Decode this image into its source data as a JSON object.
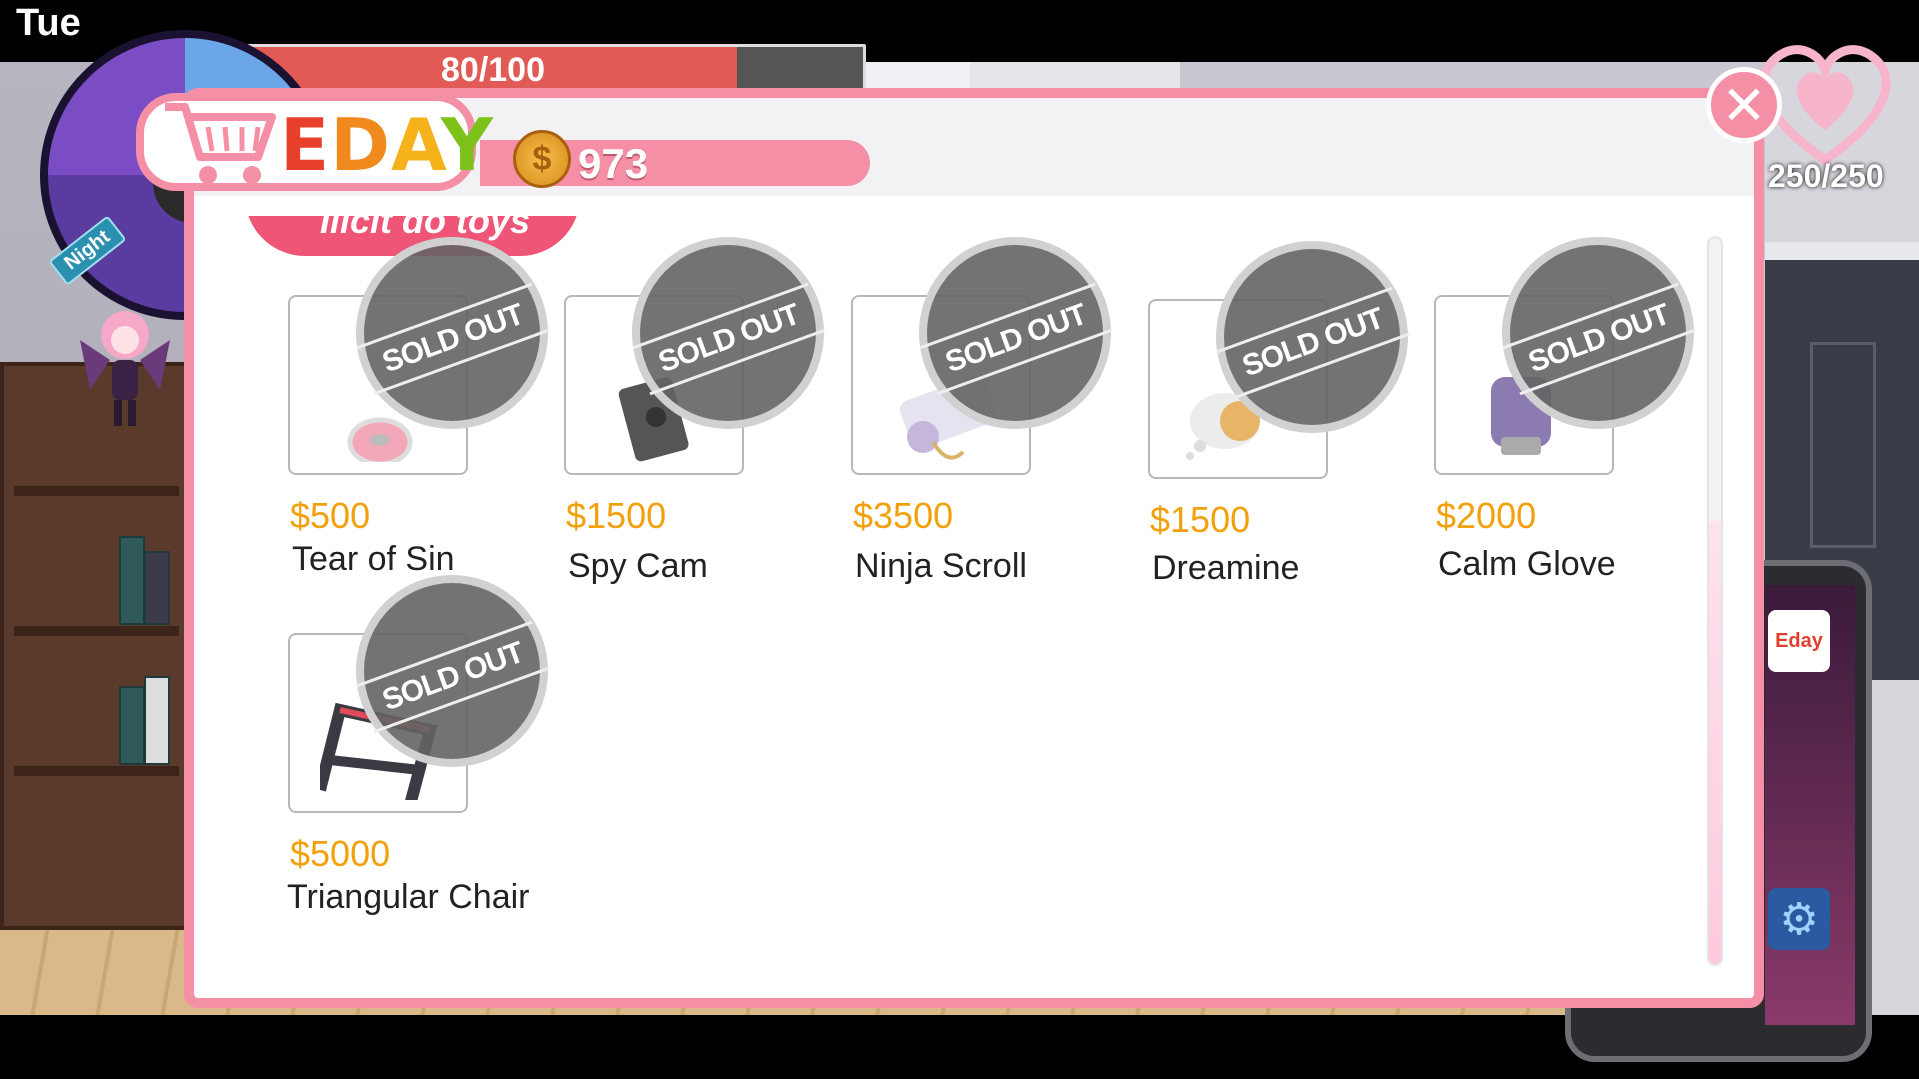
{
  "hud": {
    "day": "Tue",
    "hp": "80/100",
    "hp_fraction": 0.8,
    "time_of_day": "Night",
    "love_meter": "250/250"
  },
  "shop": {
    "logo": [
      "E",
      "D",
      "A",
      "Y"
    ],
    "coins": "973",
    "category": "Ilicit do toys",
    "sold_out_label": "SOLD OUT",
    "items": [
      {
        "name": "Tear of Sin",
        "price": "$500",
        "icon": "lollipop-icon"
      },
      {
        "name": "Spy Cam",
        "price": "$1500",
        "icon": "camera-icon"
      },
      {
        "name": "Ninja Scroll",
        "price": "$3500",
        "icon": "scroll-icon"
      },
      {
        "name": "Dreamine",
        "price": "$1500",
        "icon": "dream-bubble-icon"
      },
      {
        "name": "Calm Glove",
        "price": "$2000",
        "icon": "glove-icon"
      },
      {
        "name": "Triangular Chair",
        "price": "$5000",
        "icon": "chair-icon"
      }
    ]
  },
  "phone": {
    "app_label": "Eday",
    "settings_icon": "gear-icon"
  },
  "colors": {
    "accent_pink": "#f48fa6",
    "price_orange": "#f2a10c",
    "hp_red": "#e25a55"
  }
}
